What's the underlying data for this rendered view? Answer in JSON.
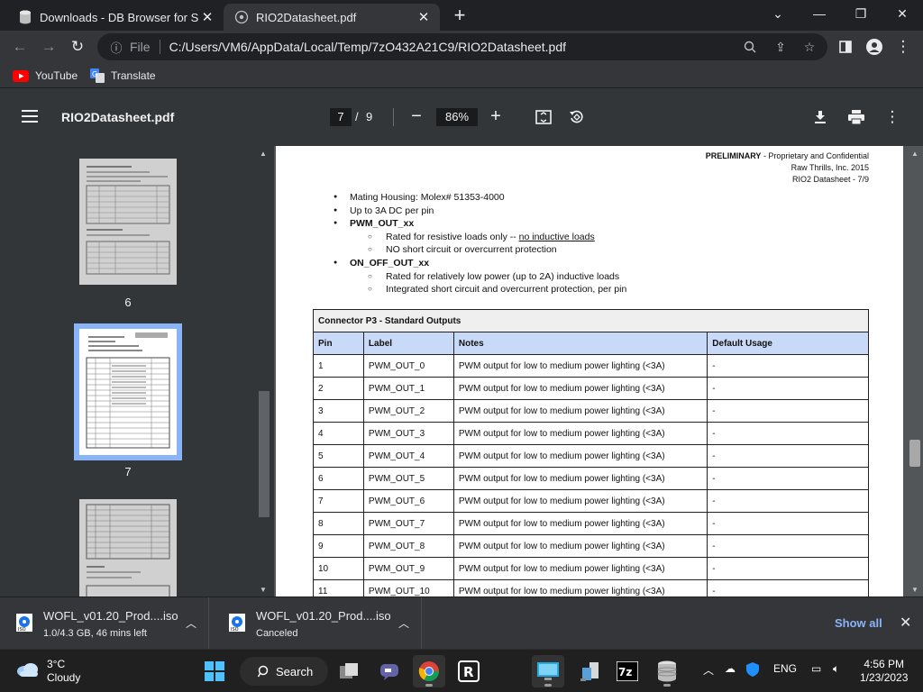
{
  "tabs": [
    {
      "title": "Downloads - DB Browser for SQL",
      "active": false
    },
    {
      "title": "RIO2Datasheet.pdf",
      "active": true
    }
  ],
  "omnibox": {
    "scheme": "File",
    "url": "C:/Users/VM6/AppData/Local/Temp/7zO432A21C9/RIO2Datasheet.pdf"
  },
  "bookmarks": [
    {
      "label": "YouTube",
      "icon": "youtube-icon"
    },
    {
      "label": "Translate",
      "icon": "translate-icon"
    }
  ],
  "pdf": {
    "title": "RIO2Datasheet.pdf",
    "current_page": "7",
    "page_sep": "/",
    "total_pages": "9",
    "zoom": "86%"
  },
  "thumbnails": [
    {
      "num": "6"
    },
    {
      "num": "7"
    }
  ],
  "page_header": {
    "line1_bold": "PRELIMINARY",
    "line1_rest": " - Proprietary and Confidential",
    "line2": "Raw Thrills, Inc. 2015",
    "line3": "RIO2 Datasheet - 7/9"
  },
  "bullets": {
    "b1": "Mating Housing: Molex# 51353-4000",
    "b2": "Up to 3A DC per pin",
    "b3": "PWM_OUT_xx",
    "b3a_pre": "Rated for resistive loads only -- ",
    "b3a_u": "no inductive loads",
    "b3b": "NO short circuit or overcurrent protection",
    "b4": "ON_OFF_OUT_xx",
    "b4a": "Rated for relatively low power (up to 2A) inductive loads",
    "b4b": "Integrated short circuit and overcurrent protection, per pin"
  },
  "table": {
    "caption": "Connector P3 - Standard Outputs",
    "headers": [
      "Pin",
      "Label",
      "Notes",
      "Default Usage"
    ],
    "rows": [
      [
        "1",
        "PWM_OUT_0",
        "PWM output for low to medium power lighting (<3A)",
        "-"
      ],
      [
        "2",
        "PWM_OUT_1",
        "PWM output for low to medium power lighting (<3A)",
        "-"
      ],
      [
        "3",
        "PWM_OUT_2",
        "PWM output for low to medium power lighting (<3A)",
        "-"
      ],
      [
        "4",
        "PWM_OUT_3",
        "PWM output for low to medium power lighting (<3A)",
        "-"
      ],
      [
        "5",
        "PWM_OUT_4",
        "PWM output for low to medium power lighting (<3A)",
        "-"
      ],
      [
        "6",
        "PWM_OUT_5",
        "PWM output for low to medium power lighting (<3A)",
        "-"
      ],
      [
        "7",
        "PWM_OUT_6",
        "PWM output for low to medium power lighting (<3A)",
        "-"
      ],
      [
        "8",
        "PWM_OUT_7",
        "PWM output for low to medium power lighting (<3A)",
        "-"
      ],
      [
        "9",
        "PWM_OUT_8",
        "PWM output for low to medium power lighting (<3A)",
        "-"
      ],
      [
        "10",
        "PWM_OUT_9",
        "PWM output for low to medium power lighting (<3A)",
        "-"
      ],
      [
        "11",
        "PWM_OUT_10",
        "PWM output for low to medium power lighting (<3A)",
        "-"
      ]
    ]
  },
  "downloads": [
    {
      "name": "WOFL_v01.20_Prod....iso",
      "status": "1.0/4.3 GB, 46 mins left"
    },
    {
      "name": "WOFL_v01.20_Prod....iso",
      "status": "Canceled"
    }
  ],
  "download_bar": {
    "show_all": "Show all"
  },
  "taskbar": {
    "weather_temp": "3°C",
    "weather_desc": "Cloudy",
    "search_label": "Search",
    "lang": "ENG",
    "time": "4:56 PM",
    "date": "1/23/2023"
  },
  "colors": {
    "accent": "#8ab4f8",
    "table_header": "#c9daf8",
    "chrome_dark": "#202124",
    "pdf_toolbar": "#323639"
  }
}
